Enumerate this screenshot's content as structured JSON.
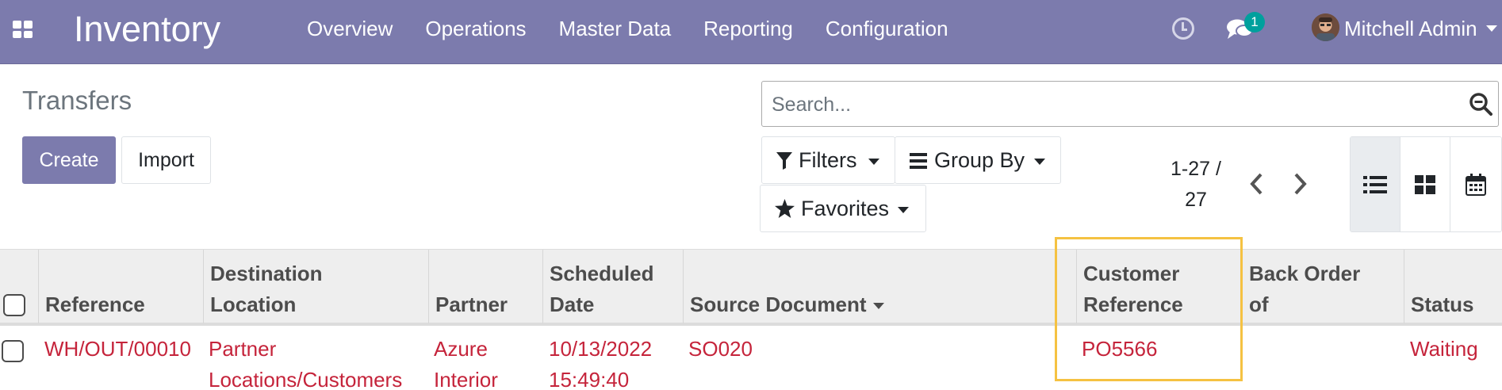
{
  "navbar": {
    "app_title": "Inventory",
    "menu": [
      "Overview",
      "Operations",
      "Master Data",
      "Reporting",
      "Configuration"
    ],
    "message_count": "1",
    "user_name": "Mitchell Admin"
  },
  "control_panel": {
    "title": "Transfers",
    "create_label": "Create",
    "import_label": "Import",
    "search_placeholder": "Search...",
    "filters_label": "Filters",
    "group_by_label": "Group By",
    "favorites_label": "Favorites",
    "pager_line1": "1-27 /",
    "pager_line2": "27"
  },
  "table": {
    "headers": {
      "reference": [
        "Reference"
      ],
      "destination": [
        "Destination",
        "Location"
      ],
      "partner": [
        "Partner"
      ],
      "scheduled": [
        "Scheduled",
        "Date"
      ],
      "source": [
        "Source Document"
      ],
      "customer_ref": [
        "Customer",
        "Reference"
      ],
      "back_order": [
        "Back Order",
        "of"
      ],
      "status": [
        "Status"
      ]
    },
    "rows": [
      {
        "reference": "WH/OUT/00010",
        "destination": [
          "Partner",
          "Locations/Customers"
        ],
        "partner": [
          "Azure",
          "Interior"
        ],
        "scheduled": [
          "10/13/2022",
          "15:49:40"
        ],
        "source": "SO020",
        "customer_ref": "PO5566",
        "back_order": "",
        "status": "Waiting"
      }
    ]
  },
  "colors": {
    "brand": "#7c7bad",
    "row_text": "#c5243b",
    "badge": "#00a09d",
    "highlight": "#f5c242"
  }
}
